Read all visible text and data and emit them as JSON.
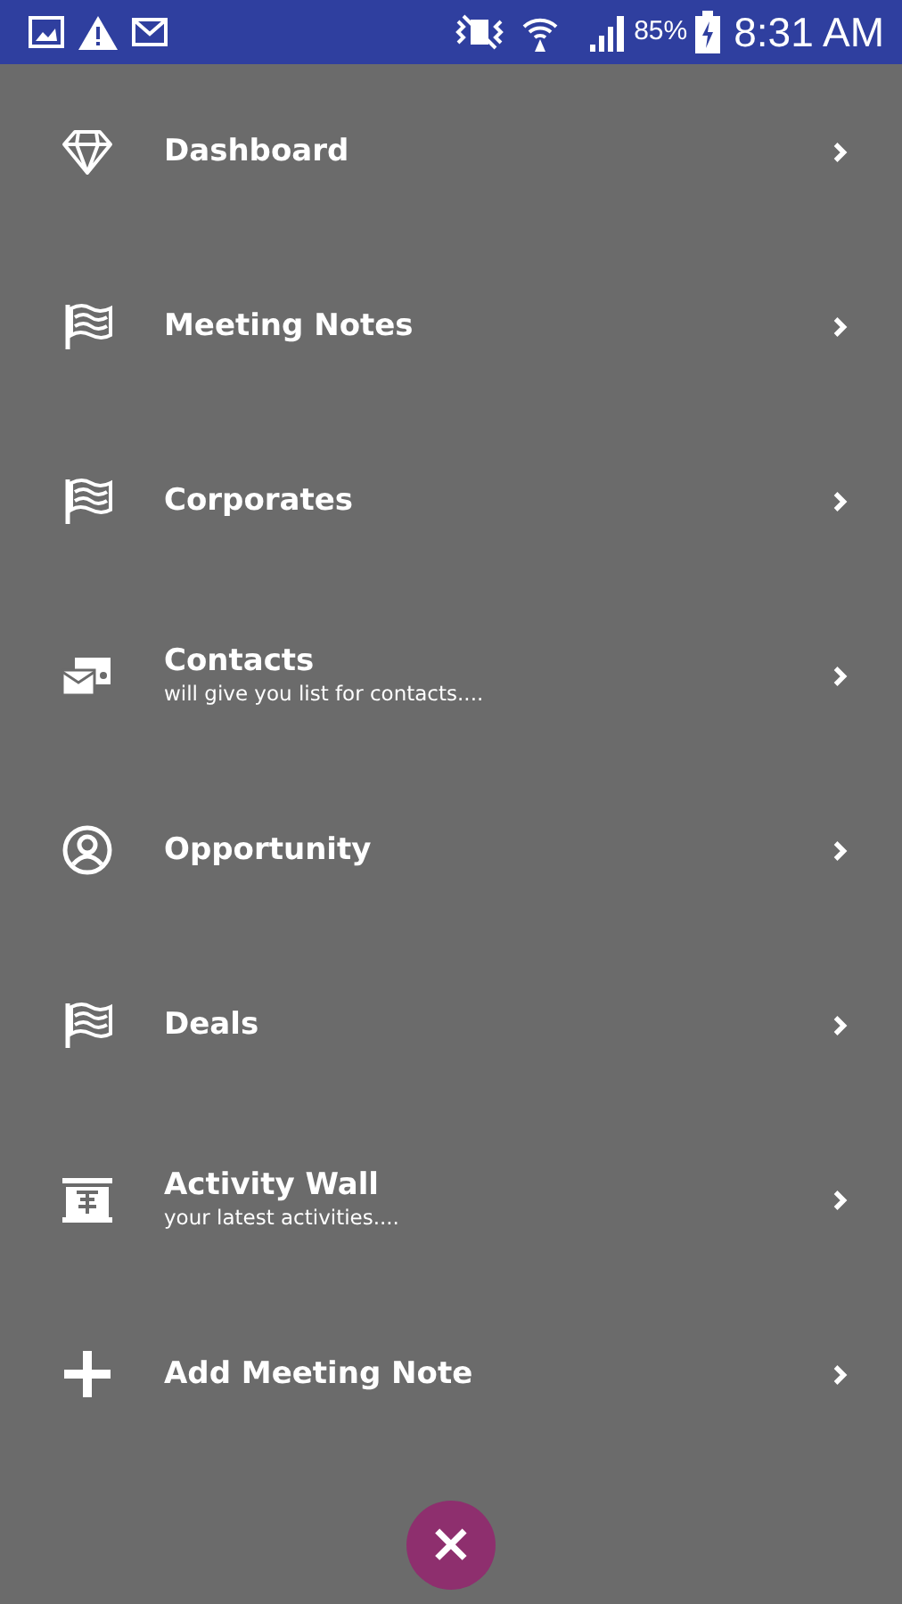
{
  "status_bar": {
    "battery": "85%",
    "time": "8:31 AM"
  },
  "menu": [
    {
      "label": "Dashboard"
    },
    {
      "label": "Meeting Notes"
    },
    {
      "label": "Corporates"
    },
    {
      "label": "Contacts",
      "subtitle": "will give you list for contacts...."
    },
    {
      "label": "Opportunity"
    },
    {
      "label": "Deals"
    },
    {
      "label": "Activity Wall",
      "subtitle": "your latest activities...."
    },
    {
      "label": "Add Meeting Note"
    }
  ],
  "close_button": {
    "label": "×"
  }
}
